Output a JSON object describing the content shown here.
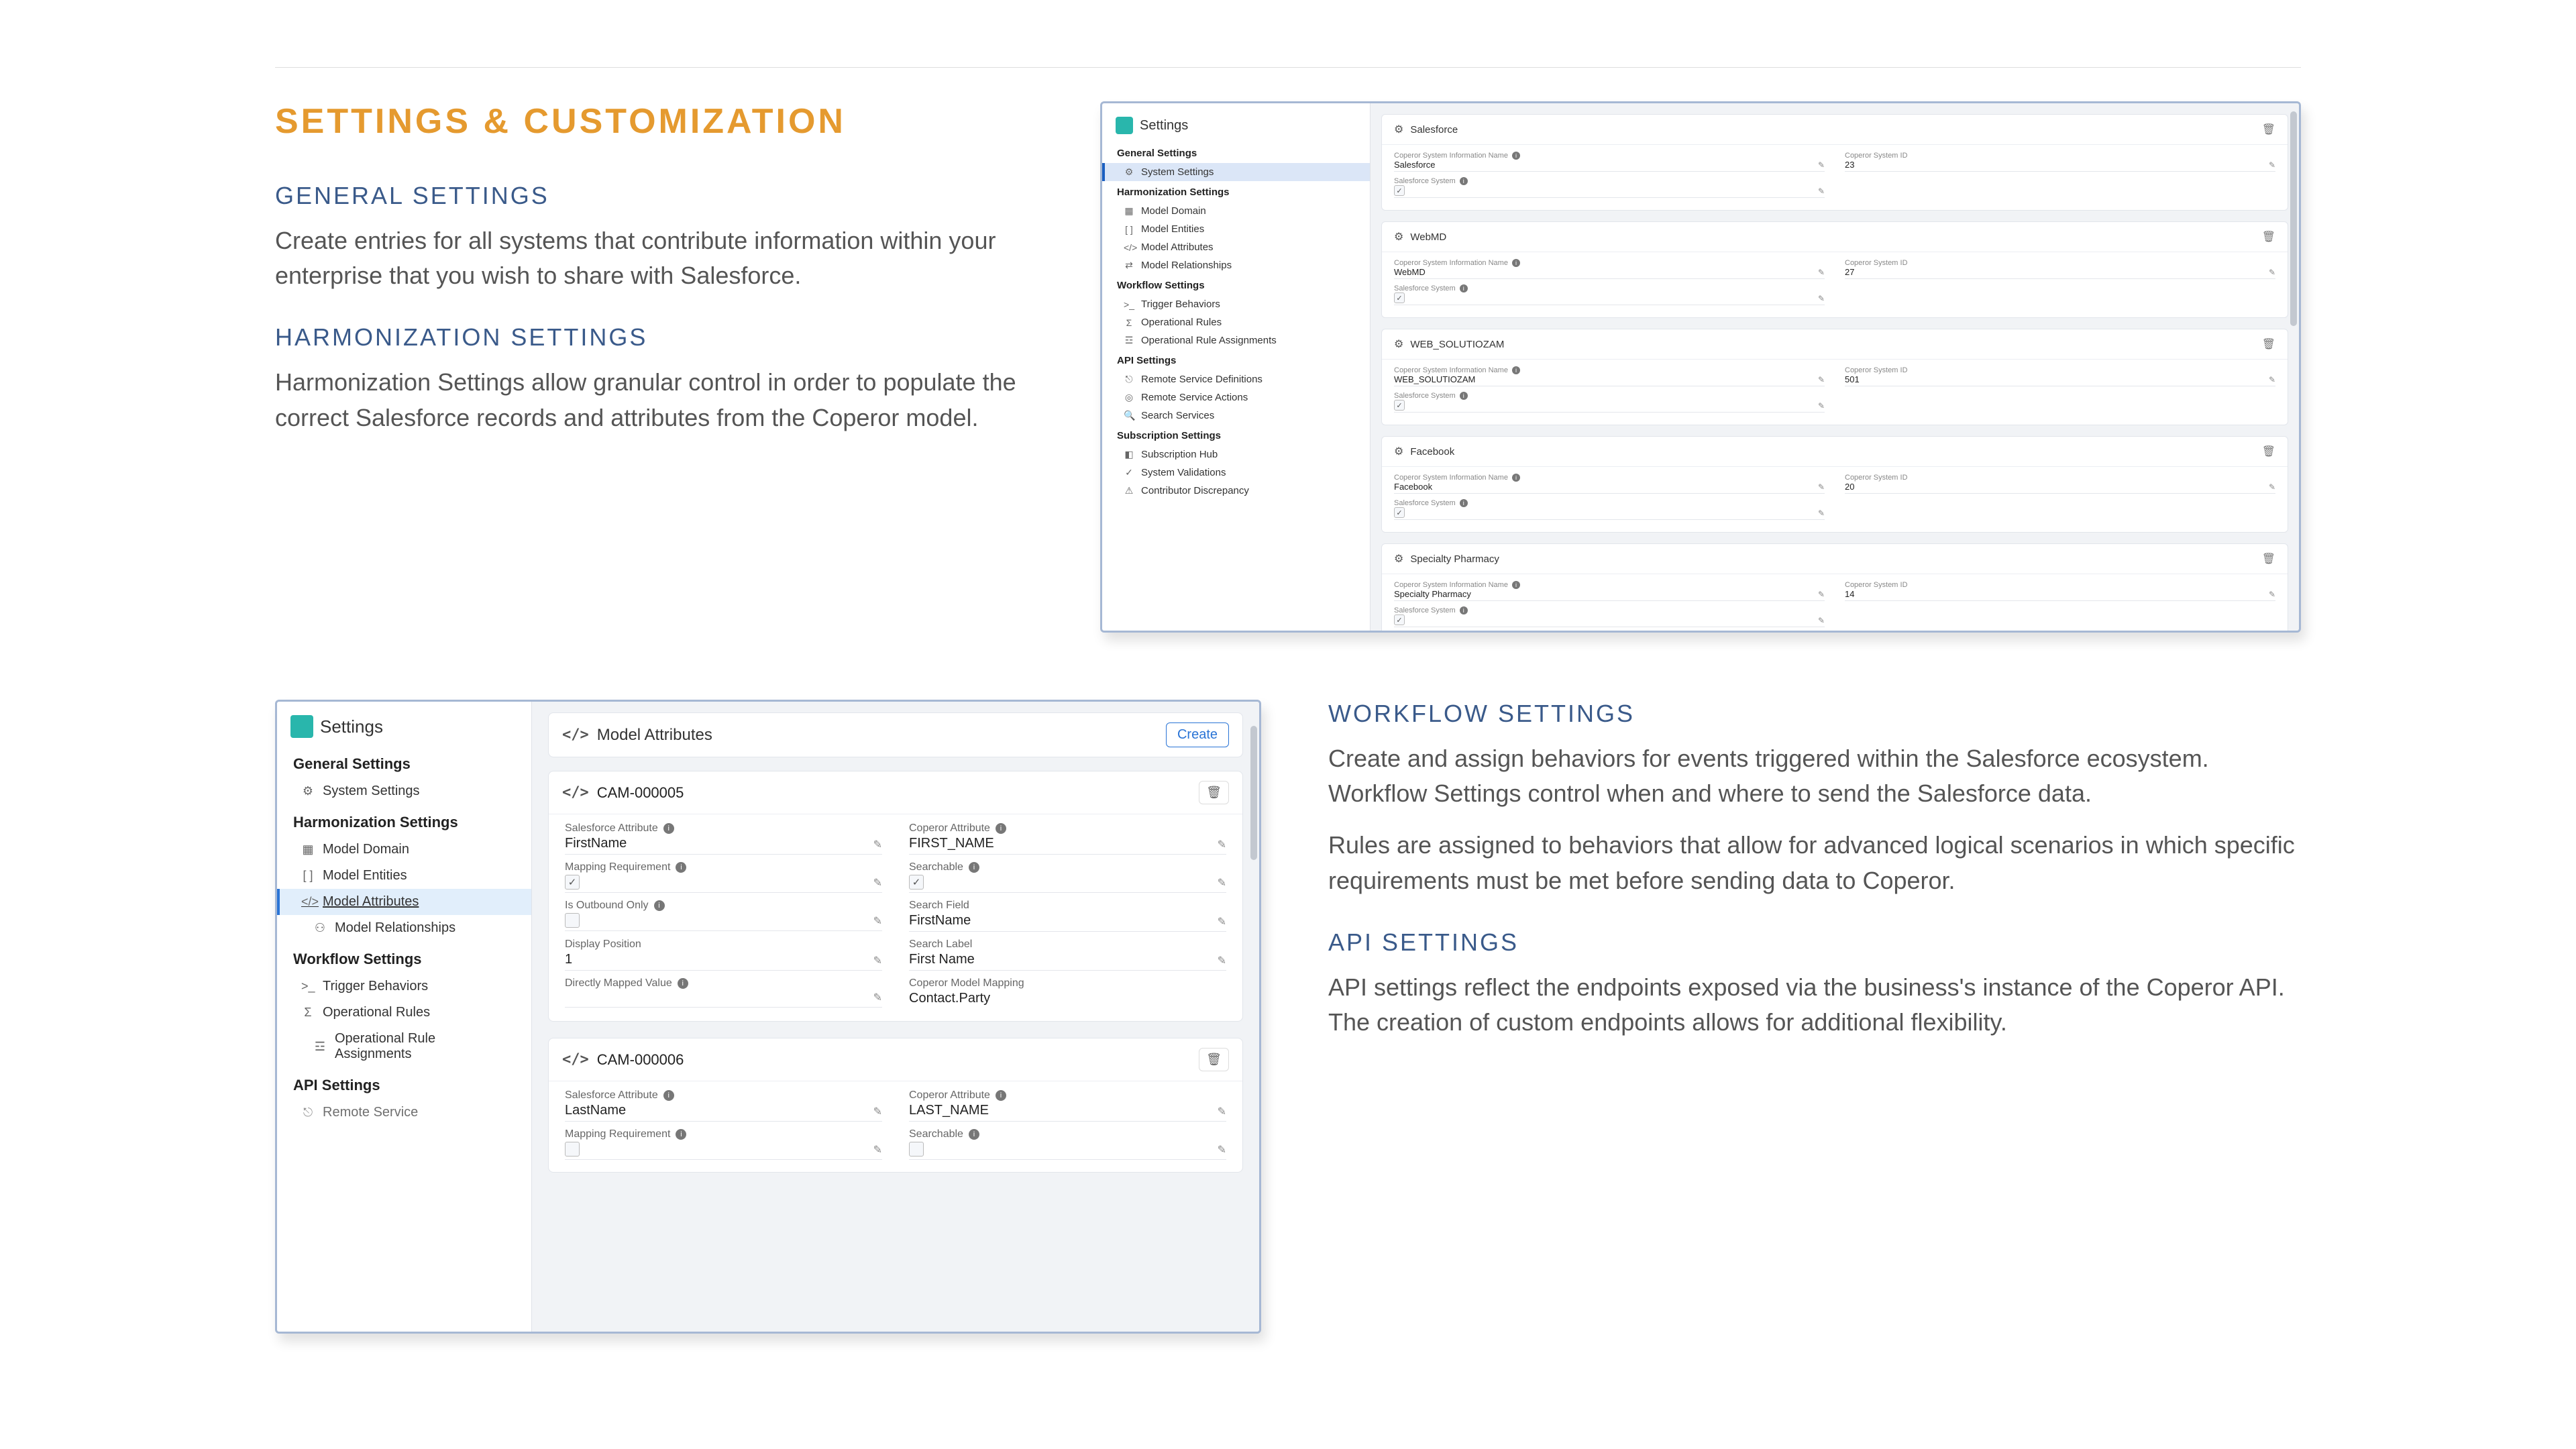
{
  "page_title": "SETTINGS & CUSTOMIZATION",
  "sections": {
    "general": {
      "heading": "GENERAL SETTINGS",
      "para": "Create entries for all systems that contribute information within your enterprise that you wish to share with Salesforce."
    },
    "harmonization": {
      "heading": "HARMONIZATION SETTINGS",
      "para": "Harmonization Settings allow granular control in order to populate the correct Salesforce records and attributes from the Coperor model."
    },
    "workflow": {
      "heading": "WORKFLOW SETTINGS",
      "para1": "Create and assign behaviors for events triggered within the Salesforce ecosystem. Workflow Settings control when and where to send the Salesforce data.",
      "para2": "Rules are assigned to behaviors that allow for advanced logical scenarios in which specific requirements must be met before sending data to Coperor."
    },
    "api": {
      "heading": "API SETTINGS",
      "para": "API settings reflect the endpoints exposed via the business's instance of the Coperor API. The creation of custom endpoints allows for additional flexibility."
    }
  },
  "shot1": {
    "sidebar_title": "Settings",
    "groups": {
      "general": "General Settings",
      "harmonization": "Harmonization Settings",
      "workflow": "Workflow Settings",
      "api": "API Settings",
      "subscription": "Subscription Settings"
    },
    "items": {
      "system_settings": "System Settings",
      "model_domain": "Model Domain",
      "model_entities": "Model Entities",
      "model_attributes": "Model Attributes",
      "model_relationships": "Model Relationships",
      "trigger_behaviors": "Trigger Behaviors",
      "operational_rules": "Operational Rules",
      "op_rule_assignments": "Operational Rule Assignments",
      "remote_service_defs": "Remote Service Definitions",
      "remote_service_actions": "Remote Service Actions",
      "search_services": "Search Services",
      "subscription_hub": "Subscription Hub",
      "system_validations": "System Validations",
      "contributor_discrepancy": "Contributor Discrepancy"
    },
    "labels": {
      "name": "Coperor System Information Name",
      "id": "Coperor System ID",
      "system": "Salesforce System"
    },
    "systems": [
      {
        "title": "Salesforce",
        "name": "Salesforce",
        "id": "23"
      },
      {
        "title": "WebMD",
        "name": "WebMD",
        "id": "27"
      },
      {
        "title": "WEB_SOLUTIOZAM",
        "name": "WEB_SOLUTIOZAM",
        "id": "501"
      },
      {
        "title": "Facebook",
        "name": "Facebook",
        "id": "20"
      },
      {
        "title": "Specialty Pharmacy",
        "name": "Specialty Pharmacy",
        "id": "14"
      }
    ]
  },
  "shot2": {
    "sidebar_title": "Settings",
    "groups": {
      "general": "General Settings",
      "harmonization": "Harmonization Settings",
      "workflow": "Workflow Settings",
      "api": "API Settings"
    },
    "items": {
      "system_settings": "System Settings",
      "model_domain": "Model Domain",
      "model_entities": "Model Entities",
      "model_attributes": "Model Attributes",
      "model_relationships": "Model Relationships",
      "trigger_behaviors": "Trigger Behaviors",
      "operational_rules": "Operational Rules",
      "op_rule_assignments": "Operational Rule Assignments",
      "remote_service": "Remote Service"
    },
    "header": {
      "title": "Model Attributes",
      "create": "Create"
    },
    "labels": {
      "sf_attr": "Salesforce Attribute",
      "cop_attr": "Coperor Attribute",
      "mapping_req": "Mapping Requirement",
      "searchable": "Searchable",
      "outbound": "Is Outbound Only",
      "search_field": "Search Field",
      "display_pos": "Display Position",
      "search_label": "Search Label",
      "direct_map": "Directly Mapped Value",
      "model_map": "Coperor Model Mapping"
    },
    "cards": [
      {
        "code": "CAM-000005",
        "sf_attr": "FirstName",
        "cop_attr": "FIRST_NAME",
        "mapping_req": true,
        "searchable": true,
        "outbound": false,
        "search_field": "FirstName",
        "display_pos": "1",
        "search_label": "First Name",
        "direct_map": "",
        "model_map": "Contact.Party"
      },
      {
        "code": "CAM-000006",
        "sf_attr": "LastName",
        "cop_attr": "LAST_NAME",
        "mapping_req": "",
        "searchable": ""
      }
    ]
  }
}
